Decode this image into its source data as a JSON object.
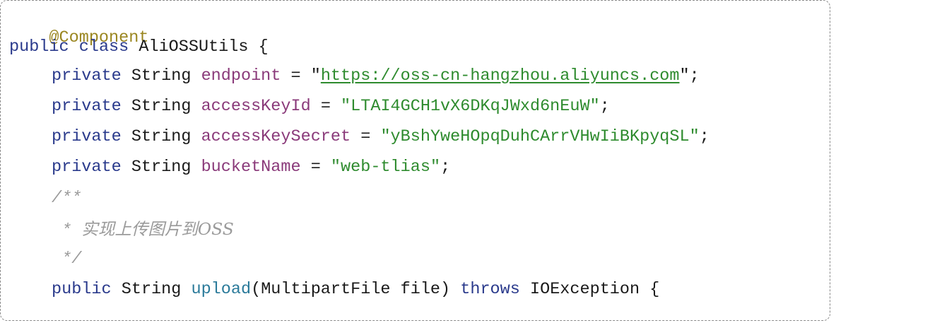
{
  "code": {
    "annotation": "@Component",
    "class_decl": {
      "kw_public": "public",
      "kw_class": "class",
      "class_name": "AliOSSUtils",
      "brace": "{"
    },
    "fields": [
      {
        "kw": "private",
        "type": "String",
        "name": "endpoint",
        "op": "=",
        "quote_open": "\"",
        "value": "https://oss-cn-hangzhou.aliyuncs.com",
        "quote_close": "\"",
        "end": ";"
      },
      {
        "kw": "private",
        "type": "String",
        "name": "accessKeyId",
        "op": "=",
        "literal": "\"LTAI4GCH1vX6DKqJWxd6nEuW\"",
        "end": ";"
      },
      {
        "kw": "private",
        "type": "String",
        "name": "accessKeySecret",
        "op": "=",
        "literal": "\"yBshYweHOpqDuhCArrVHwIiBKpyqSL\"",
        "end": ";"
      },
      {
        "kw": "private",
        "type": "String",
        "name": "bucketName",
        "op": "=",
        "literal": "\"web-tlias\"",
        "end": ";"
      }
    ],
    "comment": {
      "open": "/**",
      "star": "*",
      "text": "实现上传图片到OSS",
      "close": "*/"
    },
    "method_decl": {
      "kw_public": "public",
      "return_type": "String",
      "name": "upload",
      "params": "(MultipartFile file)",
      "kw_throws": "throws",
      "exception": "IOException",
      "brace": "{"
    }
  }
}
